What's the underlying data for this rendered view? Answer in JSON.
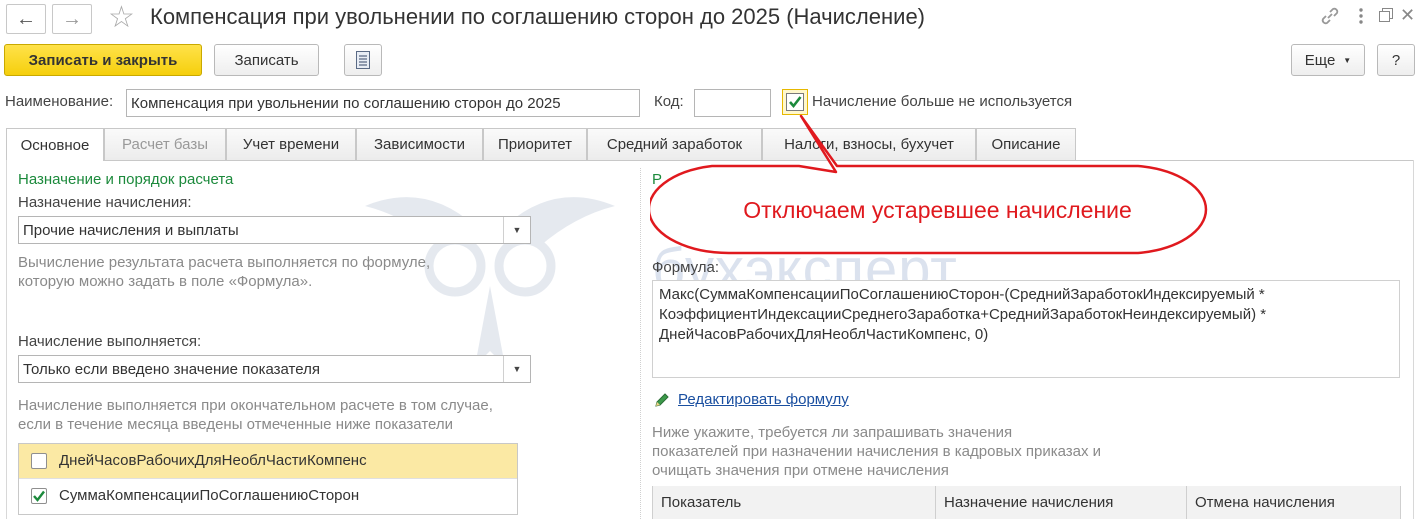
{
  "window": {
    "title": "Компенсация при увольнении по соглашению сторон до 2025 (Начисление)"
  },
  "toolbar": {
    "save_close": "Записать и закрыть",
    "save": "Записать",
    "more": "Еще",
    "help": "?"
  },
  "header": {
    "name_label": "Наименование:",
    "name_value": "Компенсация при увольнении по соглашению сторон до 2025",
    "code_label": "Код:",
    "code_value": "",
    "not_used_label": "Начисление больше не используется",
    "not_used_checked": true
  },
  "tabs": [
    {
      "label": "Основное",
      "state": "active"
    },
    {
      "label": "Расчет базы",
      "state": "disabled"
    },
    {
      "label": "Учет времени",
      "state": "normal"
    },
    {
      "label": "Зависимости",
      "state": "normal"
    },
    {
      "label": "Приоритет",
      "state": "normal"
    },
    {
      "label": "Средний заработок",
      "state": "normal"
    },
    {
      "label": "Налоги, взносы, бухучет",
      "state": "normal"
    },
    {
      "label": "Описание",
      "state": "normal"
    }
  ],
  "left": {
    "section_title": "Назначение и порядок расчета",
    "purpose_label": "Назначение начисления:",
    "purpose_value": "Прочие начисления и выплаты",
    "purpose_hint_1": "Вычисление результата расчета выполняется по формуле,",
    "purpose_hint_2": "которую можно задать в поле «Формула».",
    "executed_label": "Начисление выполняется:",
    "executed_value": "Только если введено значение показателя",
    "executed_hint_1": "Начисление выполняется при окончательном расчете в том случае,",
    "executed_hint_2": "если в течение месяца введены отмеченные ниже показатели",
    "indicators": [
      {
        "label": "ДнейЧасовРабочихДляНеоблЧастиКомпенс",
        "checked": false
      },
      {
        "label": "СуммаКомпенсацииПоСоглашениюСторон",
        "checked": true
      }
    ]
  },
  "right": {
    "section_title": "Р",
    "formula_label": "Формула:",
    "formula_lines": [
      "Макс(СуммаКомпенсацииПоСоглашениюСторон-(СреднийЗаработокИндексируемый *",
      "КоэффициентИндексацииСреднегоЗаработка+СреднийЗаработокНеиндексируемый) *",
      "ДнейЧасовРабочихДляНеоблЧастиКомпенс, 0)"
    ],
    "edit_formula_link": "Редактировать формулу",
    "hint_1": "Ниже укажите, требуется ли запрашивать значения",
    "hint_2": "показателей при назначении начисления в кадровых приказах и",
    "hint_3": "очищать значения при отмене начисления",
    "table_headers": [
      "Показатель",
      "Назначение начисления",
      "Отмена начисления"
    ]
  },
  "callout": {
    "text": "Отключаем устаревшее начисление"
  },
  "watermark": {
    "text": "бухэксперт"
  },
  "colors": {
    "primary_button": "#f5cf0c",
    "section_green": "#1c8a3c",
    "link_blue": "#1a4fa0",
    "callout_red": "#e0191e",
    "highlight_row": "#fbe9a4"
  },
  "icons": [
    "back-arrow-icon",
    "forward-arrow-icon",
    "star-icon",
    "document-list-icon",
    "link-icon",
    "more-vertical-icon",
    "restore-window-icon",
    "close-icon",
    "pencil-icon",
    "checkmark-icon"
  ]
}
